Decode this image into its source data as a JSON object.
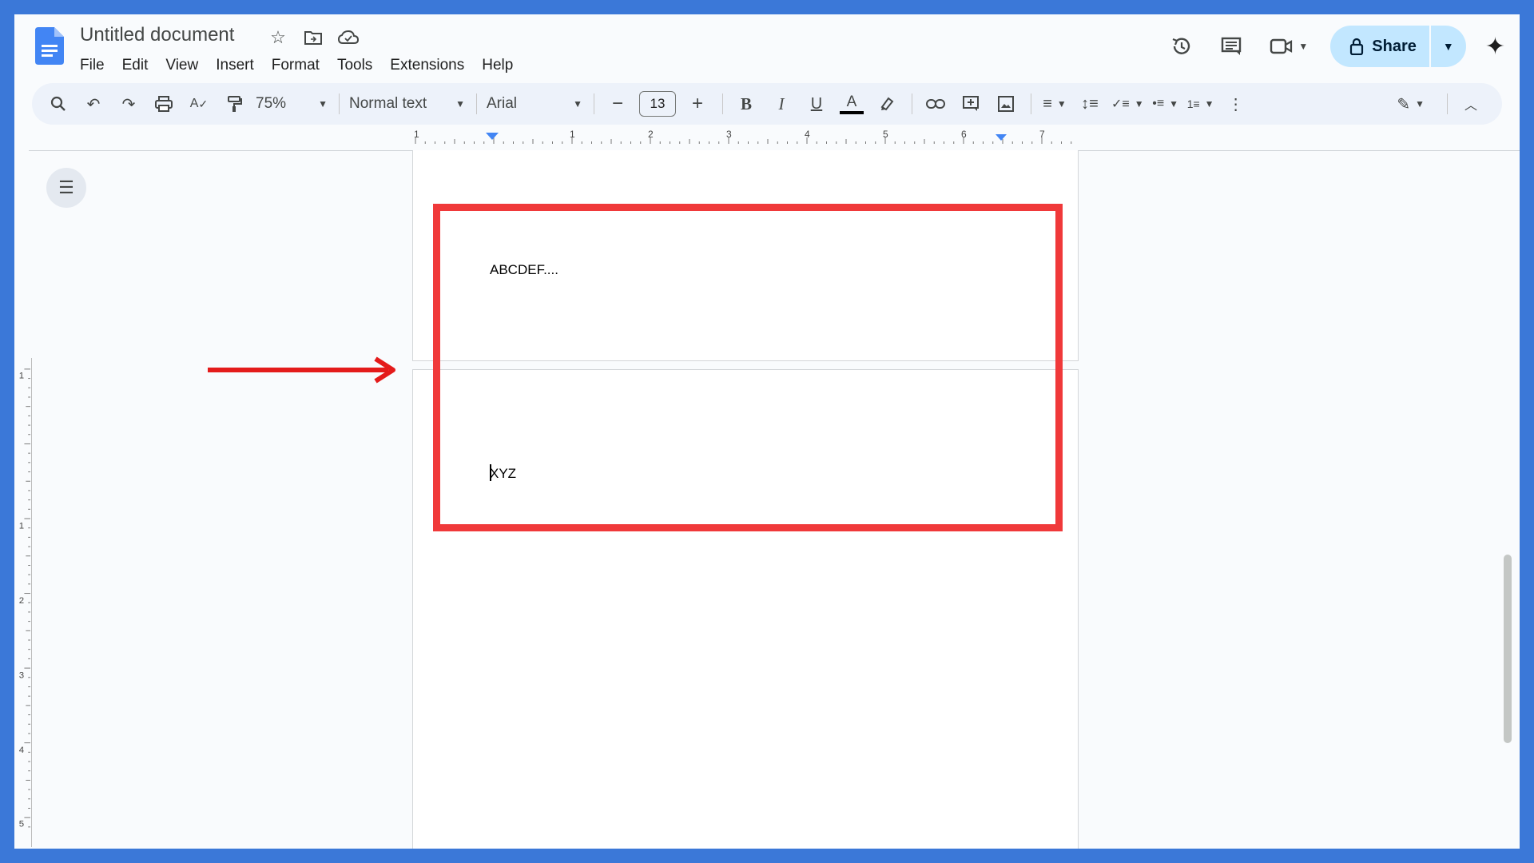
{
  "doc": {
    "title": "Untitled document"
  },
  "menu": [
    "File",
    "Edit",
    "View",
    "Insert",
    "Format",
    "Tools",
    "Extensions",
    "Help"
  ],
  "share": {
    "label": "Share"
  },
  "toolbar": {
    "zoom": "75%",
    "style": "Normal text",
    "font": "Arial",
    "font_size": "13"
  },
  "ruler_labels": [
    "1",
    "1",
    "2",
    "3",
    "4",
    "5",
    "6",
    "7"
  ],
  "vruler_labels": [
    "1",
    "1",
    "2",
    "3",
    "4",
    "5"
  ],
  "content": {
    "page1_text": "ABCDEF....",
    "page2_text": "XYZ"
  },
  "annotation": {
    "color": "#f0393a",
    "arrow_color": "#e41b1b"
  },
  "colors": {
    "accent": "#3b78d8",
    "share_bg": "#c2e7ff",
    "toolbar_bg": "#edf2fa"
  }
}
